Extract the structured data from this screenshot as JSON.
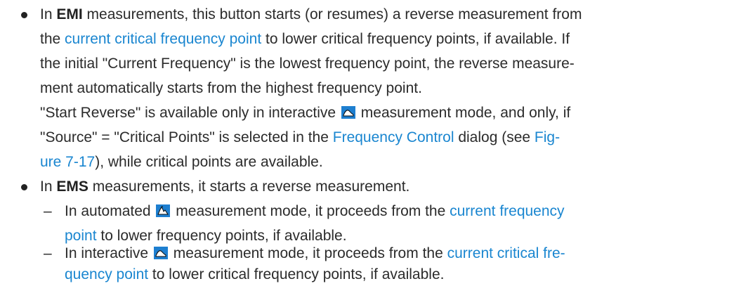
{
  "bullet1": {
    "l1_pre": "In ",
    "l1_bold": "EMI",
    "l1_post": " measurements, this button starts (or resumes) a reverse measurement from",
    "l2_pre": "the ",
    "l2_link": "current critical frequency point",
    "l2_post": " to lower critical frequency points, if available. If",
    "l3": "the initial \"Current Frequency\" is the lowest frequency point, the reverse measure-",
    "l4": "ment automatically starts from the highest frequency point.",
    "l5_pre": "\"Start Reverse\" is available only in interactive",
    "l5_post": "measurement mode, and only, if",
    "l6_pre": "\"Source\" = \"Critical Points\" is selected in the ",
    "l6_link": "Frequency Control",
    "l6_mid": " dialog (see ",
    "l6_link2": "Fig-",
    "l7_link": "ure 7-17",
    "l7_post": "), while critical points are available."
  },
  "bullet2": {
    "l1_pre": "In ",
    "l1_bold": "EMS",
    "l1_post": " measurements, it starts a reverse measurement."
  },
  "sub1": {
    "dash": "–",
    "l1_pre": "In automated",
    "l1_mid": "measurement mode, it proceeds from the ",
    "l1_link": "current frequency",
    "l2_link": "point",
    "l2_post": " to lower frequency points, if available."
  },
  "sub2": {
    "dash": "–",
    "l1_pre": "In interactive",
    "l1_mid": "measurement mode, it proceeds from the ",
    "l1_link": "current critical fre-",
    "l2_link": "quency point",
    "l2_post": " to lower critical frequency points, if available."
  },
  "icons": {
    "interactive": "interactive-mode-icon",
    "automated": "automated-mode-icon"
  },
  "colors": {
    "link": "#1a86d0",
    "icon_bg": "#1e7fd0",
    "text": "#2b2b2b"
  }
}
